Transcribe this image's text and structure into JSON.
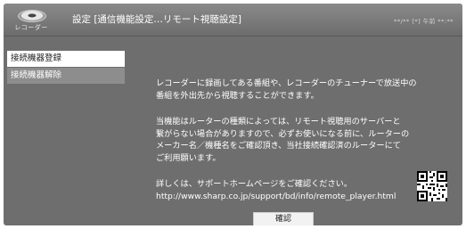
{
  "header": {
    "logo_label": "レコーダー",
    "title": "設定 [通信機能設定…リモート視聴設定]",
    "datetime": "**/** [*] 午前 **:**"
  },
  "menu": {
    "items": [
      {
        "label": "接続機器登録",
        "selected": true
      },
      {
        "label": "接続機器解除",
        "selected": false
      }
    ]
  },
  "content": {
    "paragraph1": [
      "レコーダーに録画してある番組や、レコーダーのチューナーで放送中の",
      "番組を外出先から視聴することができます。"
    ],
    "paragraph2": [
      "当機能はルーターの種類によっては、リモート視聴用のサーバーと",
      "繋がらない場合がありますので、必ずお使いになる前に、ルーターの",
      "メーカー名／機種名をご確認頂き、当社接続確認済のルーターにて",
      "ご利用願います。"
    ],
    "paragraph3": [
      "詳しくは、サポートホームページをご確認ください。",
      "http://www.sharp.co.jp/support/bd/info/remote_player.html"
    ]
  },
  "buttons": {
    "confirm_label": "確認"
  },
  "colors": {
    "background": "#6e6e6e",
    "header": "#7b7b7b",
    "selected_item": "#ffffff",
    "menu_item": "#8d8d8d"
  }
}
